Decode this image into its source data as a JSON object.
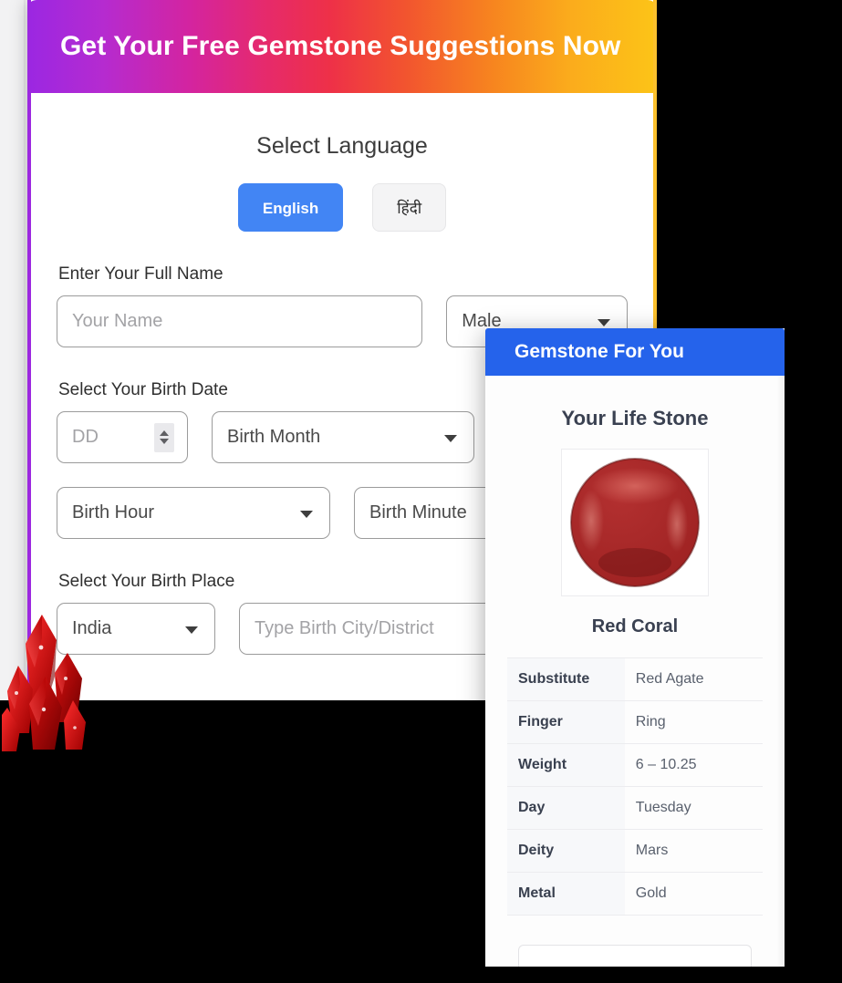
{
  "form": {
    "header_title": "Get Your Free Gemstone Suggestions Now",
    "language_section_title": "Select Language",
    "language_buttons": [
      {
        "label": "English",
        "selected": true
      },
      {
        "label": "हिंदी",
        "selected": false
      }
    ],
    "name_label": "Enter Your Full Name",
    "name_placeholder": "Your Name",
    "gender_value": "Male",
    "birth_date_label": "Select Your Birth Date",
    "day_placeholder": "DD",
    "month_value": "Birth Month",
    "hour_value": "Birth Hour",
    "minute_value": "Birth Minute",
    "birth_place_label": "Select Your Birth Place",
    "country_value": "India",
    "city_placeholder": "Type Birth City/District"
  },
  "gemstone_card": {
    "header_title": "Gemstone For You",
    "subtitle": "Your Life Stone",
    "stone_image_alt": "red-coral-cabochon",
    "stone_name": "Red Coral",
    "attributes": [
      {
        "key": "Substitute",
        "value": "Red Agate"
      },
      {
        "key": "Finger",
        "value": "Ring"
      },
      {
        "key": "Weight",
        "value": "6 – 10.25"
      },
      {
        "key": "Day",
        "value": "Tuesday"
      },
      {
        "key": "Deity",
        "value": "Mars"
      },
      {
        "key": "Metal",
        "value": "Gold"
      }
    ]
  },
  "decoration": {
    "crystal_alt": "red-crystal-cluster"
  },
  "colors": {
    "gradient_start": "#9b27e2",
    "gradient_mid": "#ee3048",
    "gradient_end": "#fcc417",
    "accent_blue": "#2563eb",
    "button_blue": "#4285f4",
    "stone_red": "#a32222",
    "background": "#000000"
  }
}
